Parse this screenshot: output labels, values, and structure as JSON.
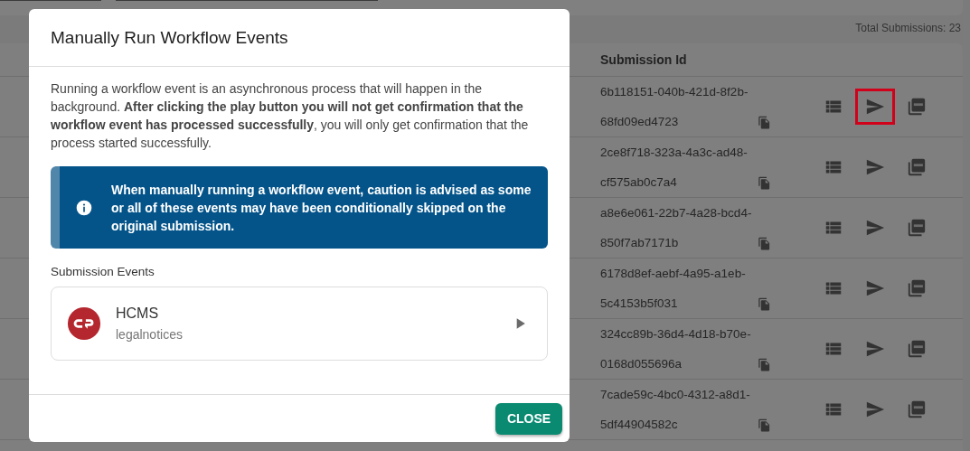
{
  "page": {
    "total": "Total Submissions: 23",
    "table": {
      "columns": [
        "Submission Id"
      ],
      "rows": [
        {
          "submission_id": "6b118151-040b-421d-8f2b-68fd09ed4723",
          "send_highlighted": true
        },
        {
          "submission_id": "2ce8f718-323a-4a3c-ad48-cf575ab0c7a4",
          "send_highlighted": false
        },
        {
          "submission_id": "a8e6e061-22b7-4a28-bcd4-850f7ab7171b",
          "send_highlighted": false
        },
        {
          "submission_id": "6178d8ef-aebf-4a95-a1eb-5c4153b5f031",
          "send_highlighted": false
        },
        {
          "submission_id": "324cc89b-36d4-4d18-b70e-0168d055696a",
          "send_highlighted": false
        },
        {
          "submission_id": "7cade59c-4bc0-4312-a8d1-5df44904582c",
          "send_highlighted": false
        }
      ]
    }
  },
  "dialog": {
    "title": "Manually Run Workflow Events",
    "description": "Running a workflow event is an asynchronous process that will happen in the background. **After clicking the play button you will not get confirmation that the workflow event has processed successfully**, you will only get confirmation that the process started successfully.",
    "alert": "When manually running a workflow event, caution is advised as some or all of these events may have been conditionally skipped on the original submission.",
    "section_label": "Submission Events",
    "events": [
      {
        "name": "HCMS",
        "subtitle": "legalnotices"
      }
    ],
    "close_button": "CLOSE"
  }
}
